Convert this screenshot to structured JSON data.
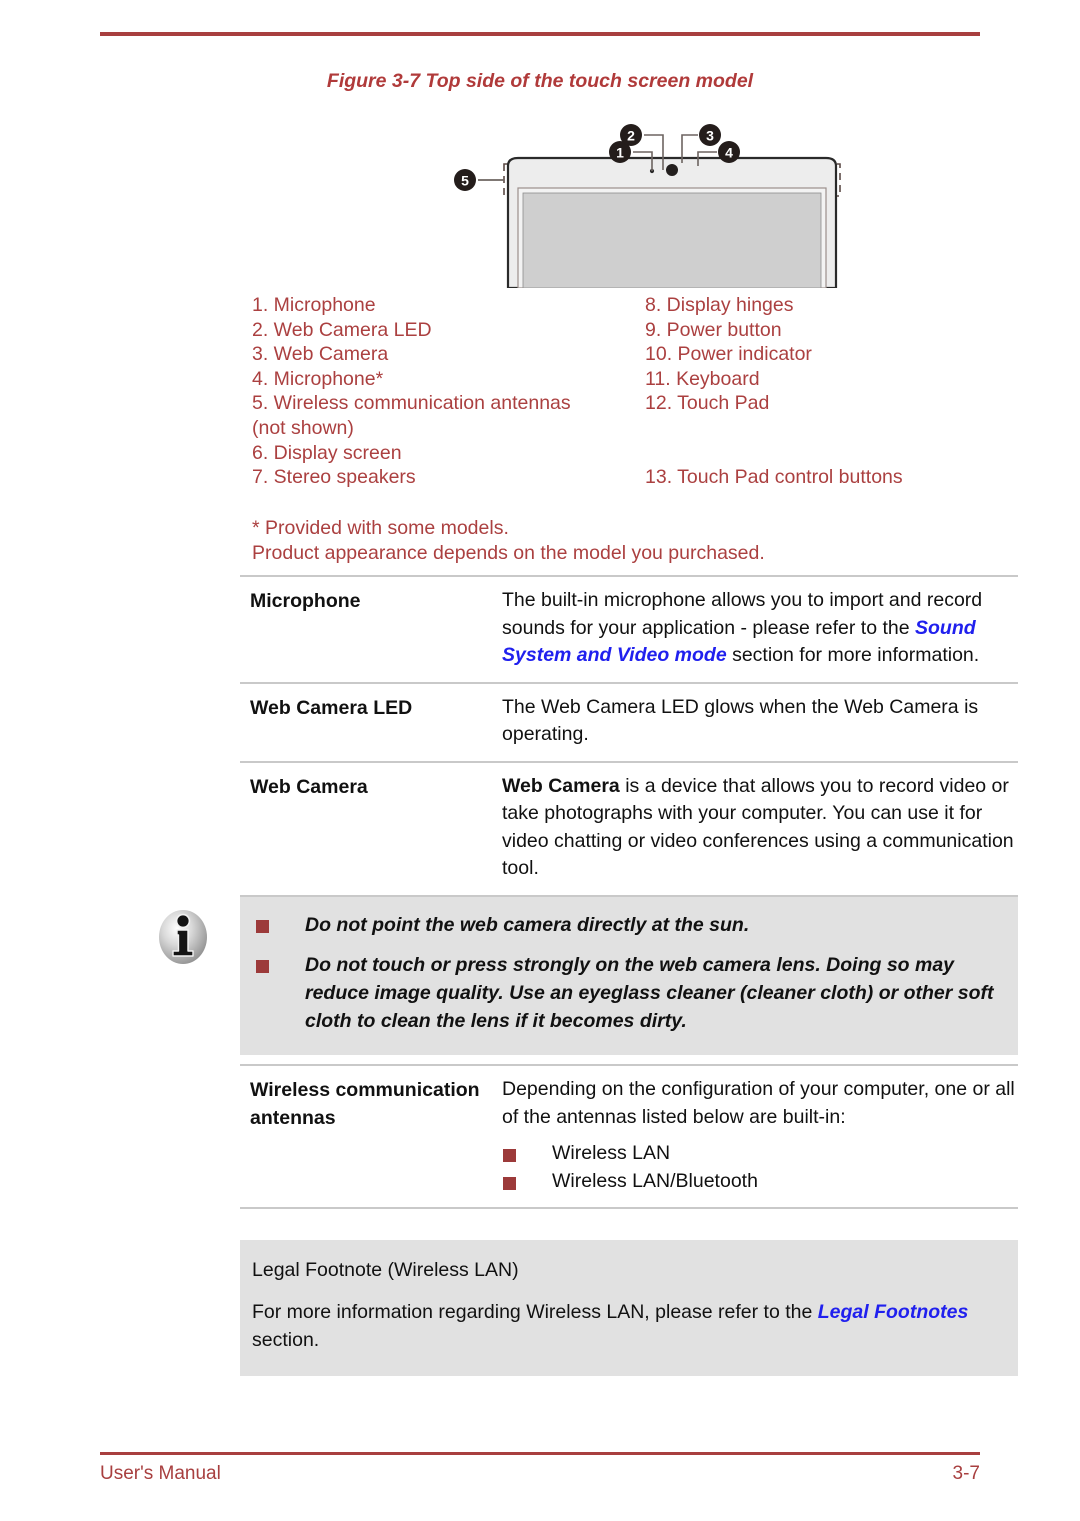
{
  "figure": {
    "caption": "Figure 3-7 Top side of the touch screen model",
    "callouts": [
      "1",
      "2",
      "3",
      "4",
      "5"
    ]
  },
  "legend": {
    "left": [
      "1. Microphone",
      "2. Web Camera LED",
      "3. Web Camera",
      "4. Microphone*",
      "5. Wireless communication antennas",
      "(not shown)",
      "6. Display screen",
      "7. Stereo speakers"
    ],
    "right": [
      "8. Display hinges",
      "9. Power button",
      "10. Power indicator",
      "11. Keyboard",
      "12. Touch Pad",
      "13. Touch Pad control buttons"
    ]
  },
  "starnote": {
    "line1": "* Provided with some models.",
    "line2": "Product appearance depends on the model you purchased."
  },
  "definitions": [
    {
      "term": "Microphone",
      "desc_pre": "The built-in microphone allows you to import and record sounds for your application - please refer to the ",
      "link": "Sound System and Video mode",
      "desc_post": " section for more information."
    },
    {
      "term": "Web Camera LED",
      "desc_pre": "The Web Camera LED glows when the Web Camera is operating.",
      "link": "",
      "desc_post": ""
    },
    {
      "term": "Web Camera",
      "bold_lead": "Web Camera",
      "desc_pre": " is a device that allows you to record video or take photographs with your computer. You can use it for video chatting or video conferences using a communication tool.",
      "link": "",
      "desc_post": ""
    }
  ],
  "notebox": {
    "icon": "info-icon",
    "items": [
      "Do not point the web camera directly at the sun.",
      "Do not touch or press strongly on the web camera lens. Doing so may reduce image quality. Use an eyeglass cleaner (cleaner cloth) or other soft cloth to clean the lens if it becomes dirty."
    ]
  },
  "wireless": {
    "term": "Wireless communication antennas",
    "desc": "Depending on the configuration of your computer, one or all of the antennas listed below are built-in:",
    "bullets": [
      "Wireless LAN",
      "Wireless LAN/Bluetooth"
    ]
  },
  "legal": {
    "title": "Legal Footnote (Wireless LAN)",
    "body_pre": "For more information regarding Wireless LAN, please refer to the ",
    "link": "Legal Footnotes",
    "body_post": " section."
  },
  "footer": {
    "left": "User's Manual",
    "right": "3-7"
  },
  "colors": {
    "accent_red": "#a83f3f",
    "legend_red": "#ab4040",
    "link_blue": "#2020ee",
    "bullet_red": "#9c3a3a",
    "box_gray": "#e1e1e1",
    "rule_gray": "#c9c9c9"
  }
}
